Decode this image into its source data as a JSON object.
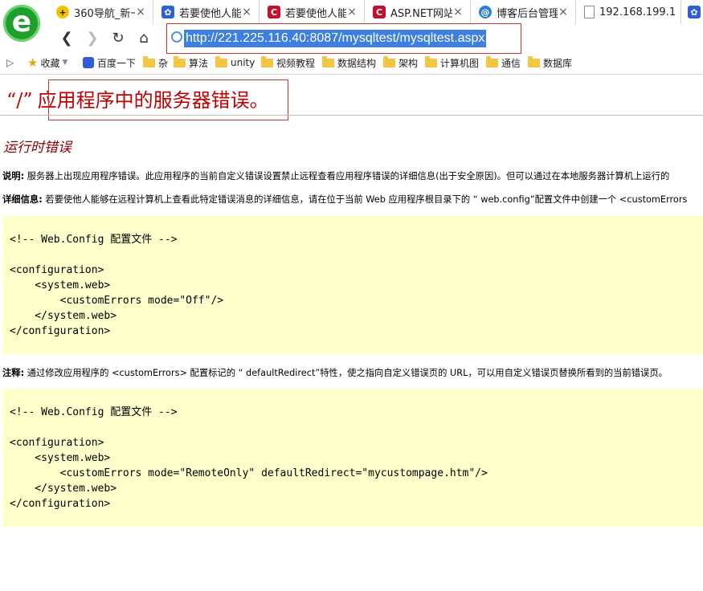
{
  "browser": {
    "tabs": [
      {
        "label": "360导航_新一",
        "icon": "360-nav-icon",
        "color": "#f2c200"
      },
      {
        "label": "若要使他人能",
        "icon": "baidu-paw-icon",
        "color": "#2e5fd8"
      },
      {
        "label": "若要使他人能",
        "icon": "csdn-icon",
        "color": "#c8102e"
      },
      {
        "label": "ASP.NET网站",
        "icon": "csdn-icon",
        "color": "#c8102e"
      },
      {
        "label": "博客后台管理",
        "icon": "blog-icon",
        "color": "#2e7bd8"
      },
      {
        "label": "192.168.199.1",
        "icon": "page-icon",
        "color": "#888888"
      }
    ],
    "tab_close": "×",
    "url": "http://221.225.116.40:8087/mysqltest/mysqltest.aspx",
    "bookmarks": [
      "收藏",
      "百度一下",
      "杂",
      "算法",
      "unity",
      "视频教程",
      "数据结构",
      "架构",
      "计算机图",
      "通信",
      "数据库"
    ]
  },
  "page": {
    "title_slash": "“/”",
    "title": "应用程序中的服务器错误。",
    "subtitle": "运行时错误",
    "desc_label": "说明:",
    "desc_text": " 服务器上出现应用程序错误。此应用程序的当前自定义错误设置禁止远程查看应用程序错误的详细信息(出于安全原因)。但可以通过在本地服务器计算机上运行的",
    "details_label": "详细信息:",
    "details_text": " 若要使他人能够在远程计算机上查看此特定错误消息的详细信息，请在位于当前  Web 应用程序根目录下的 “ web.config”配置文件中创建一个  <customErrors",
    "code1": "\n<!-- Web.Config 配置文件 -->\n\n<configuration>\n    <system.web>\n        <customErrors mode=\"Off\"/>\n    </system.web>\n</configuration>",
    "note_label": "注释:",
    "note_text": " 通过修改应用程序的  <customErrors> 配置标记的 “ defaultRedirect”特性，使之指向自定义错误页的  URL，可以用自定义错误页替换所看到的当前错误页。",
    "code2": "\n<!-- Web.Config 配置文件 -->\n\n<configuration>\n    <system.web>\n        <customErrors mode=\"RemoteOnly\" defaultRedirect=\"mycustompage.htm\"/>\n    </system.web>\n</configuration>"
  }
}
